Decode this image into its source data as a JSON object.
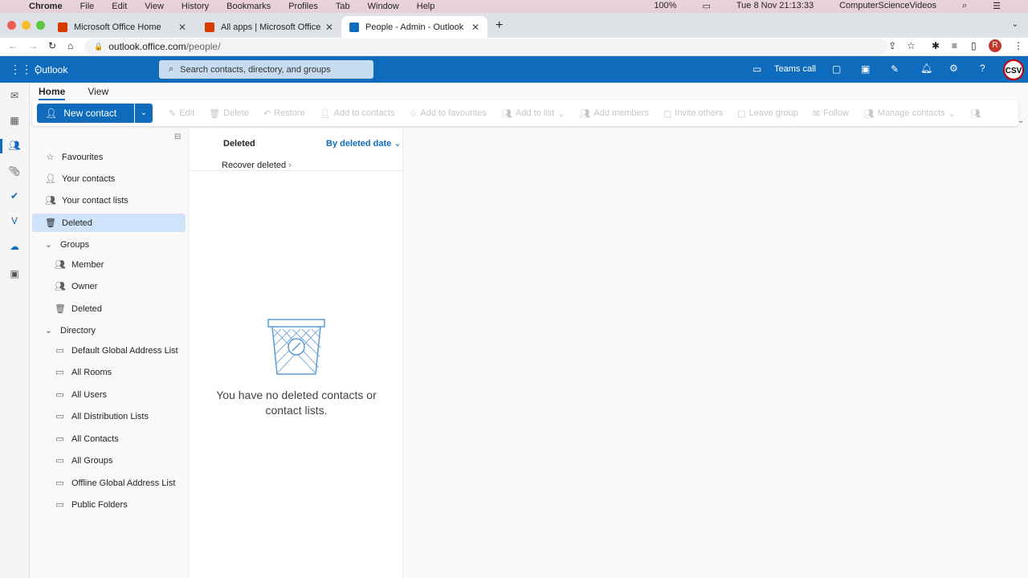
{
  "mac_menu": {
    "items": [
      "Chrome",
      "File",
      "Edit",
      "View",
      "History",
      "Bookmarks",
      "Profiles",
      "Tab",
      "Window",
      "Help"
    ],
    "battery": "100%",
    "datetime": "Tue 8 Nov  21:13:33",
    "user": "ComputerScienceVideos"
  },
  "browser": {
    "tabs": [
      {
        "label": "Microsoft Office Home"
      },
      {
        "label": "All apps | Microsoft Office"
      },
      {
        "label": "People - Admin - Outlook"
      }
    ],
    "url_host": "outlook.office.com",
    "url_path": "/people/",
    "profile": "R"
  },
  "header": {
    "app": "Outlook",
    "search_placeholder": "Search contacts, directory, and groups",
    "teams_call": "Teams call",
    "avatar": "CSV"
  },
  "ribbon": {
    "tabs": [
      "Home",
      "View"
    ],
    "new_contact": "New contact",
    "buttons": [
      "Edit",
      "Delete",
      "Restore",
      "Add to contacts",
      "Add to favourites",
      "Add to list",
      "Add members",
      "Invite others",
      "Leave group",
      "Follow",
      "Manage contacts"
    ]
  },
  "folders": {
    "top": [
      "Favourites",
      "Your contacts",
      "Your contact lists",
      "Deleted"
    ],
    "groups_label": "Groups",
    "groups": [
      "Member",
      "Owner",
      "Deleted"
    ],
    "directory_label": "Directory",
    "directory": [
      "Default Global Address List",
      "All Rooms",
      "All Users",
      "All Distribution Lists",
      "All Contacts",
      "All Groups",
      "Offline Global Address List",
      "Public Folders"
    ]
  },
  "list": {
    "title": "Deleted",
    "sort": "By deleted date",
    "recover": "Recover deleted",
    "empty": "You have no deleted contacts or contact lists."
  },
  "colors": {
    "brand": "#0f6cbd",
    "selected": "#cfe4fa"
  }
}
